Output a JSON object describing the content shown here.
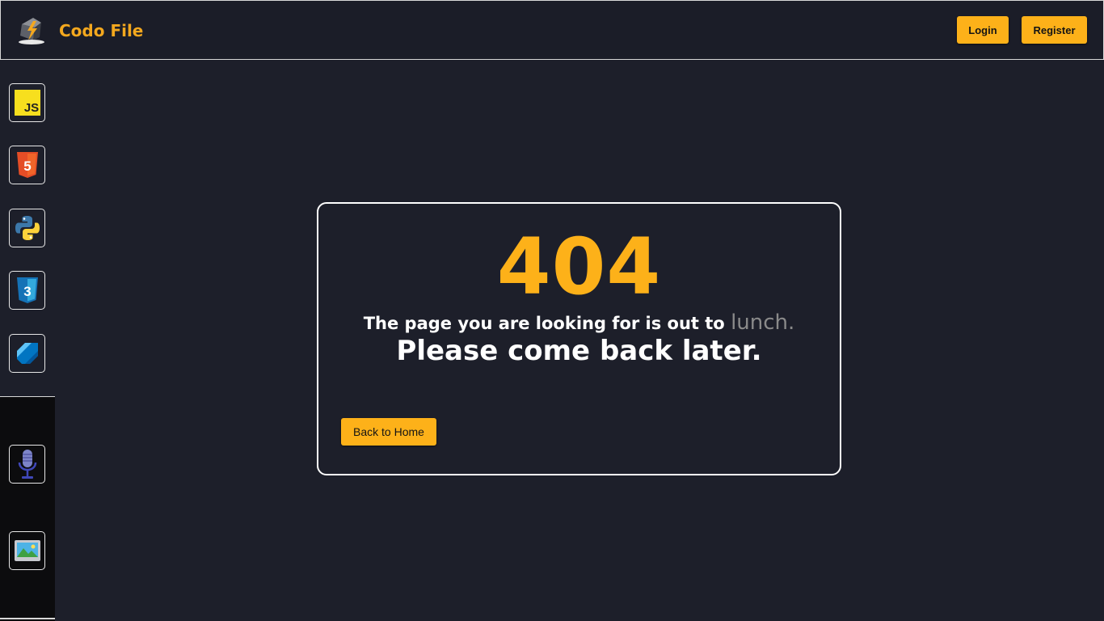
{
  "header": {
    "brand": "Codo File",
    "login_label": "Login",
    "register_label": "Register"
  },
  "sidebar": {
    "items": [
      {
        "name": "javascript",
        "icon": "javascript-icon",
        "label": "JS"
      },
      {
        "name": "html5",
        "icon": "html5-icon",
        "label": "5"
      },
      {
        "name": "python",
        "icon": "python-icon"
      },
      {
        "name": "css3",
        "icon": "css3-icon",
        "label": "3"
      },
      {
        "name": "dart",
        "icon": "dart-icon"
      },
      {
        "name": "microphone",
        "icon": "microphone-icon"
      },
      {
        "name": "image",
        "icon": "image-icon"
      }
    ]
  },
  "error": {
    "code": "404",
    "message_prefix": "The page you are looking for is out to",
    "message_accent": "lunch.",
    "message_line2": "Please come back later.",
    "back_label": "Back to Home"
  },
  "colors": {
    "accent": "#fdb119",
    "background": "#1d1f2a",
    "text": "#ffffff",
    "muted": "#8a8a8a"
  }
}
